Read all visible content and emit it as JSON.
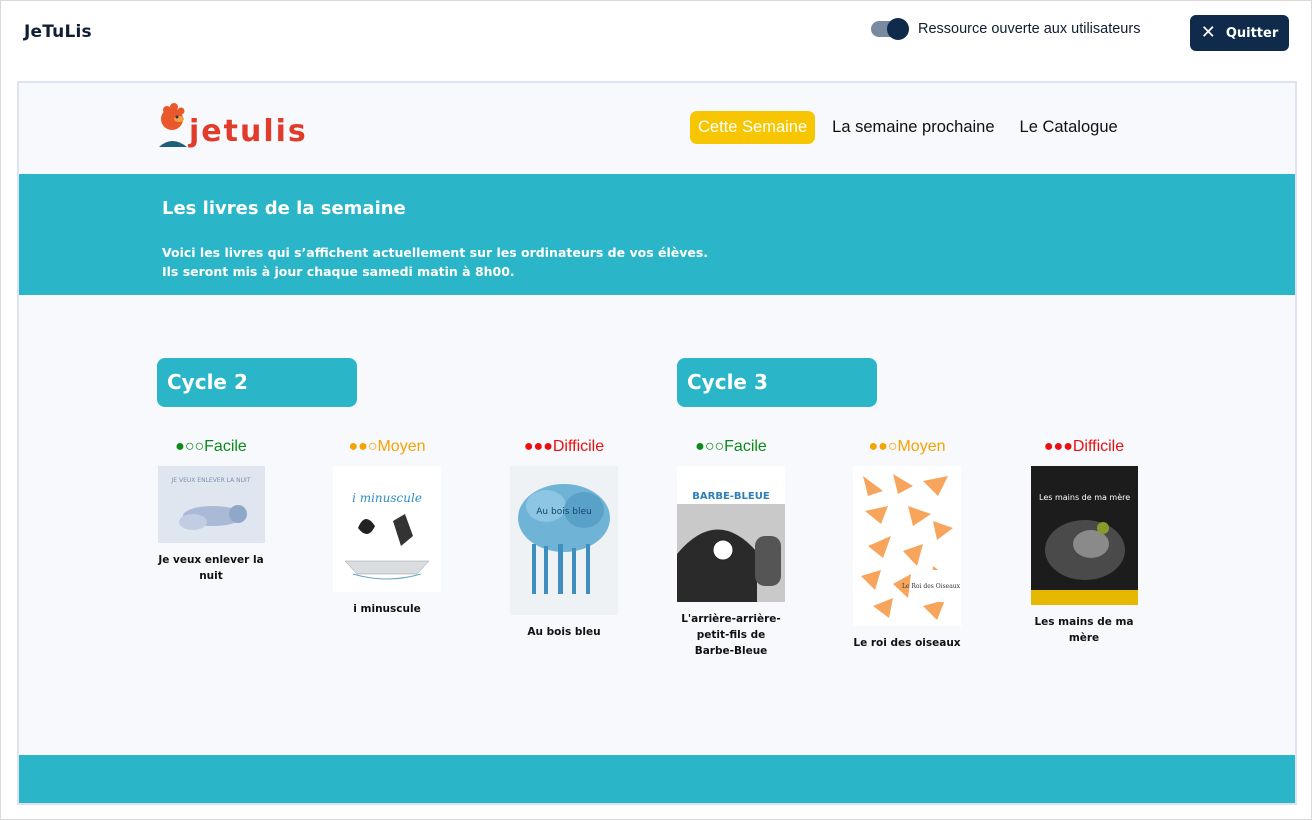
{
  "app": {
    "title": "JeTuLis"
  },
  "toggle": {
    "label": "Ressource ouverte aux utilisateurs",
    "checked": true
  },
  "quit_button": {
    "label": "Quitter"
  },
  "logo": {
    "text": "jetulis"
  },
  "nav": [
    {
      "label": "Cette Semaine",
      "active": true
    },
    {
      "label": "La semaine prochaine",
      "active": false
    },
    {
      "label": "Le Catalogue",
      "active": false
    }
  ],
  "banner": {
    "title": "Les livres de la semaine",
    "line1": "Voici les livres qui s’affichent actuellement sur les ordinateurs de vos élèves.",
    "line2": "Ils seront mis à jour chaque samedi matin à 8h00."
  },
  "cycles": [
    {
      "label": "Cycle 2",
      "books": [
        {
          "level": "●○○Facile",
          "title": "Je veux enlever la nuit"
        },
        {
          "level": "●●○Moyen",
          "title": "i minuscule"
        },
        {
          "level": "●●●Difficile",
          "title": "Au bois bleu"
        }
      ]
    },
    {
      "label": "Cycle 3",
      "books": [
        {
          "level": "●○○Facile",
          "title": "L'arrière-arrière-petit-fils de Barbe-Bleue"
        },
        {
          "level": "●●○Moyen",
          "title": "Le roi des oiseaux"
        },
        {
          "level": "●●●Difficile",
          "title": "Les mains de ma mère"
        }
      ]
    }
  ],
  "covers": {
    "c2b1": {
      "text": "JE VEUX ENLEVER LA NUIT"
    },
    "c2b2": {
      "text": "i minuscule"
    },
    "c2b3": {
      "text": "Au bois bleu"
    },
    "c3b1": {
      "text": "BARBE-BLEUE"
    },
    "c3b2": {
      "text": "Le Roi des Oiseaux"
    },
    "c3b3": {
      "text": "Les mains de ma mère"
    }
  },
  "colors": {
    "accent": "#2bb5c8",
    "nav_active": "#f7c600",
    "dark": "#0f2a4a",
    "easy": "#0b8a1a",
    "medium": "#f5a300",
    "hard": "#e81010"
  }
}
